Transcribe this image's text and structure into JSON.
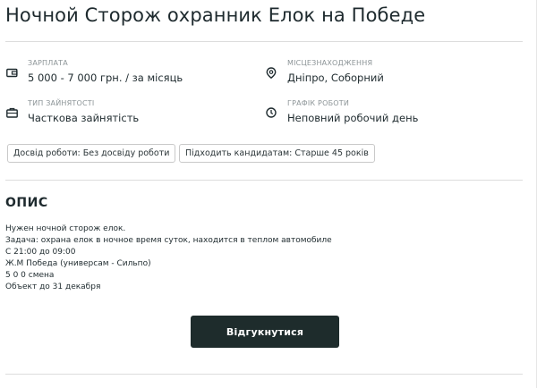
{
  "vacancy": {
    "title": "Ночной Сторож охранник Елок на Победе"
  },
  "info": {
    "salary": {
      "icon": "wallet-icon",
      "label": "ЗАРПЛАТА",
      "value": "5 000 - 7 000 грн. / за місяць"
    },
    "location": {
      "icon": "location-pin-icon",
      "label": "МІСЦЕЗНАХОДЖЕННЯ",
      "value": "Дніпро, Соборний"
    },
    "employment_type": {
      "icon": "briefcase-icon",
      "label": "ТИП ЗАЙНЯТОСТІ",
      "value": "Часткова зайнятість"
    },
    "schedule": {
      "icon": "clock-icon",
      "label": "ГРАФІК РОБОТИ",
      "value": "Неповний робочий день"
    }
  },
  "tags": [
    "Досвід роботи: Без досвіду роботи",
    "Підходить кандидатам: Старше 45 років"
  ],
  "description": {
    "heading": "ОПИС",
    "lines": [
      "Нужен ночной сторож елок.",
      "Задача: охрана елок в ночное время суток, находится в теплом автомобиле",
      "С 21:00 до 09:00",
      "Ж.М Победа (универсам - Сильпо)",
      "5 0 0 смена",
      "Объект до 31 декабря"
    ]
  },
  "actions": {
    "apply_label": "Відгукнутися"
  },
  "colors": {
    "text": "#1e2a2e",
    "muted": "#8c9497",
    "button_bg": "#1e2c2c",
    "divider": "#dcdcdc"
  }
}
